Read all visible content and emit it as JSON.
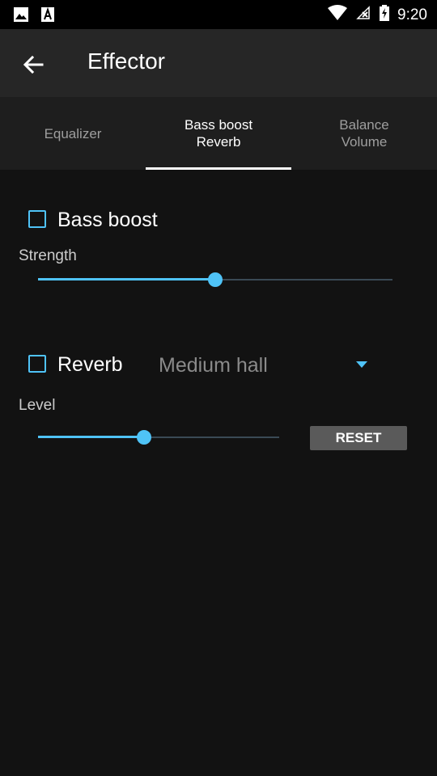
{
  "status_bar": {
    "time": "9:20",
    "icons": [
      "image-icon",
      "text-a-icon",
      "wifi-icon",
      "no-sim-icon",
      "battery-charging-icon"
    ]
  },
  "app_bar": {
    "title": "Effector",
    "back_icon": "arrow-left-icon"
  },
  "tabs": [
    {
      "line1": "Equalizer",
      "line2": "",
      "active": false
    },
    {
      "line1": "Bass boost",
      "line2": "Reverb",
      "active": true
    },
    {
      "line1": "Balance",
      "line2": "Volume",
      "active": false
    }
  ],
  "bass_boost": {
    "label": "Bass boost",
    "checked": false,
    "strength_label": "Strength",
    "strength_value": 0.5
  },
  "reverb": {
    "label": "Reverb",
    "checked": false,
    "preset": "Medium hall",
    "level_label": "Level",
    "level_value": 0.44,
    "reset_label": "RESET"
  },
  "colors": {
    "accent": "#4fc3f7",
    "background": "#121212",
    "app_bar": "#262626",
    "tab_bar": "#1e1e1e"
  }
}
